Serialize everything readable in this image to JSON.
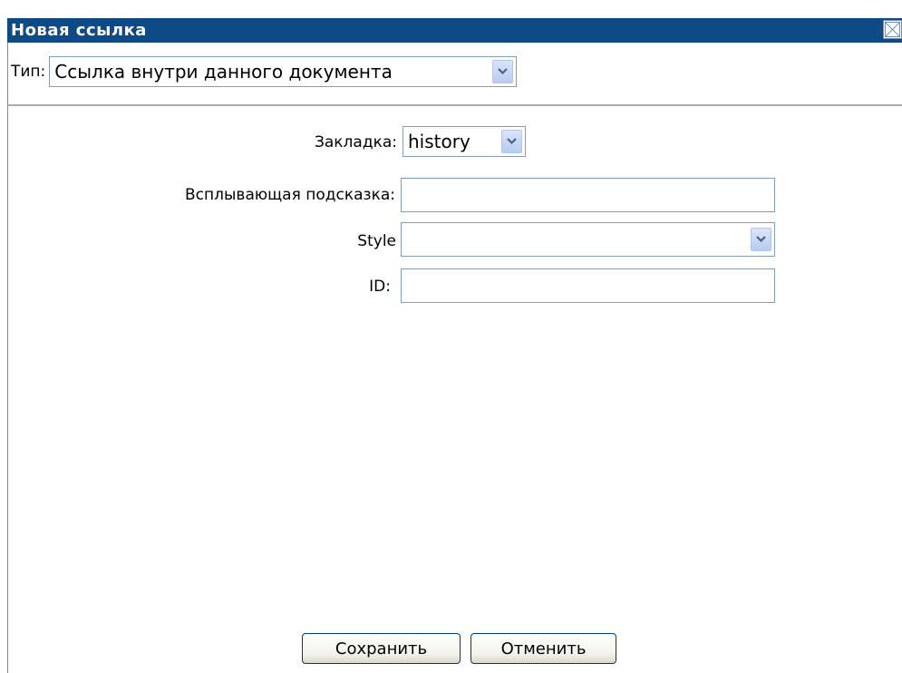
{
  "dialog": {
    "title": "Новая ссылка",
    "close_icon": "close-icon"
  },
  "type_row": {
    "label": "Тип:",
    "selected": "Ссылка внутри данного документа"
  },
  "form": {
    "bookmark_label": "Закладка:",
    "bookmark_value": "history",
    "tooltip_label": "Всплывающая подсказка:",
    "tooltip_value": "",
    "style_label": "Style",
    "style_value": "",
    "id_label": "ID:",
    "id_value": ""
  },
  "buttons": {
    "save_label": "Сохранить",
    "cancel_label": "Отменить"
  },
  "colors": {
    "title_bar": "#0e4a86",
    "input_border": "#7f9db9",
    "dropdown_button": "#b7cdf4"
  }
}
